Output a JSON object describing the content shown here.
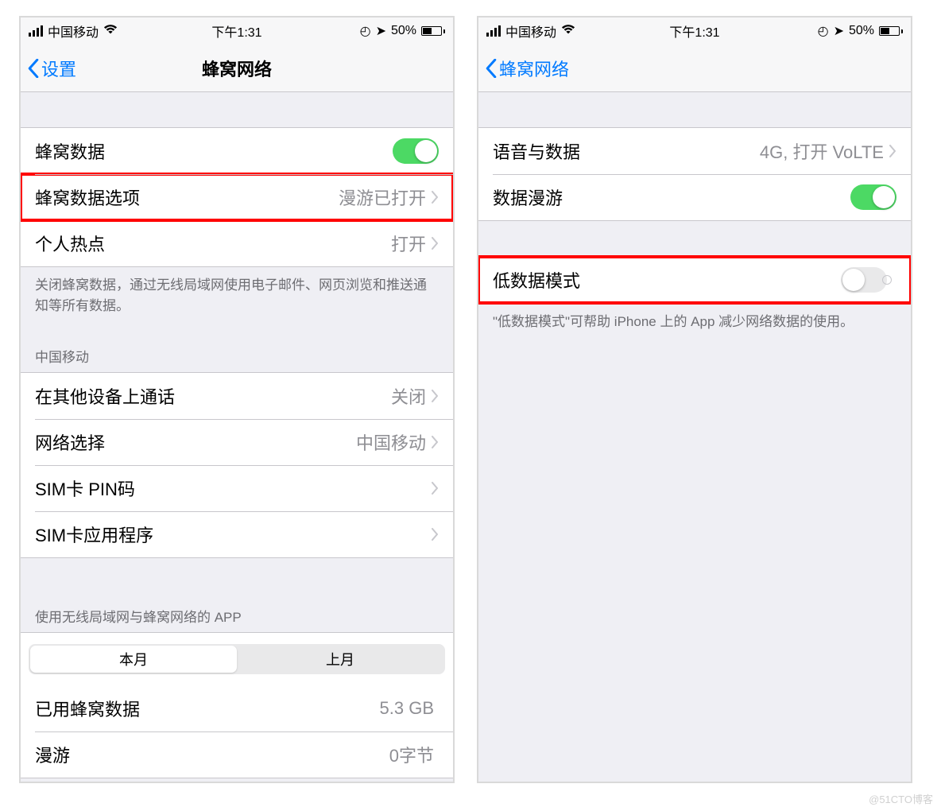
{
  "status": {
    "carrier": "中国移动",
    "time": "下午1:31",
    "battery": "50%"
  },
  "left": {
    "back": "设置",
    "title": "蜂窝网络",
    "rows": {
      "cellular_data": "蜂窝数据",
      "data_options": "蜂窝数据选项",
      "data_options_value": "漫游已打开",
      "hotspot": "个人热点",
      "hotspot_value": "打开"
    },
    "footer1": "关闭蜂窝数据，通过无线局域网使用电子邮件、网页浏览和推送通知等所有数据。",
    "section_carrier": "中国移动",
    "rows2": {
      "calls_other": "在其他设备上通话",
      "calls_other_value": "关闭",
      "network_selection": "网络选择",
      "network_selection_value": "中国移动",
      "sim_pin": "SIM卡 PIN码",
      "sim_apps": "SIM卡应用程序"
    },
    "section_apps": "使用无线局域网与蜂窝网络的 APP",
    "seg_this": "本月",
    "seg_last": "上月",
    "rows3": {
      "used_data": "已用蜂窝数据",
      "used_data_value": "5.3 GB",
      "roaming": "漫游",
      "roaming_value": "0字节"
    }
  },
  "right": {
    "back": "蜂窝网络",
    "rows": {
      "voice_data": "语音与数据",
      "voice_data_value": "4G, 打开 VoLTE",
      "data_roaming": "数据漫游"
    },
    "low_data": "低数据模式",
    "footer": "\"低数据模式\"可帮助 iPhone 上的 App 减少网络数据的使用。"
  },
  "watermark": "@51CTO博客"
}
